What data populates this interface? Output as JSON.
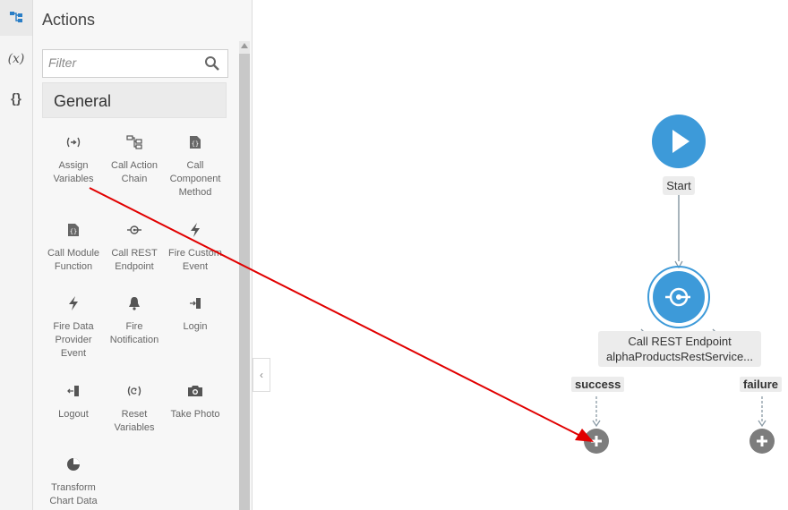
{
  "sidebar_rail": {
    "items": [
      {
        "icon": "flow-icon",
        "active": true
      },
      {
        "icon": "variables-icon",
        "label": "(x)"
      },
      {
        "icon": "braces-icon",
        "label": "{}"
      }
    ]
  },
  "actions_panel": {
    "title": "Actions",
    "filter_placeholder": "Filter",
    "section": "General",
    "items": [
      {
        "label": "Assign Variables",
        "icon": "assign-variables-icon"
      },
      {
        "label": "Call Action Chain",
        "icon": "call-action-chain-icon"
      },
      {
        "label": "Call Component Method",
        "icon": "call-component-method-icon"
      },
      {
        "label": "Call Module Function",
        "icon": "call-module-function-icon"
      },
      {
        "label": "Call REST Endpoint",
        "icon": "call-rest-endpoint-icon"
      },
      {
        "label": "Fire Custom Event",
        "icon": "lightning-icon"
      },
      {
        "label": "Fire Data Provider Event",
        "icon": "lightning-icon"
      },
      {
        "label": "Fire Notification",
        "icon": "bell-icon"
      },
      {
        "label": "Login",
        "icon": "login-icon"
      },
      {
        "label": "Logout",
        "icon": "logout-icon"
      },
      {
        "label": "Reset Variables",
        "icon": "reset-icon"
      },
      {
        "label": "Take Photo",
        "icon": "camera-icon"
      },
      {
        "label": "Transform Chart Data",
        "icon": "pie-chart-icon"
      }
    ]
  },
  "canvas": {
    "start_label": "Start",
    "rest_node": {
      "title": "Call REST Endpoint",
      "subtitle": "alphaProductsRestService..."
    },
    "branches": [
      "success",
      "failure"
    ],
    "colors": {
      "node": "#3d9ad9",
      "add": "#7d7d7d",
      "connector": "#8a9aa5",
      "arrow": "#e10000"
    }
  }
}
